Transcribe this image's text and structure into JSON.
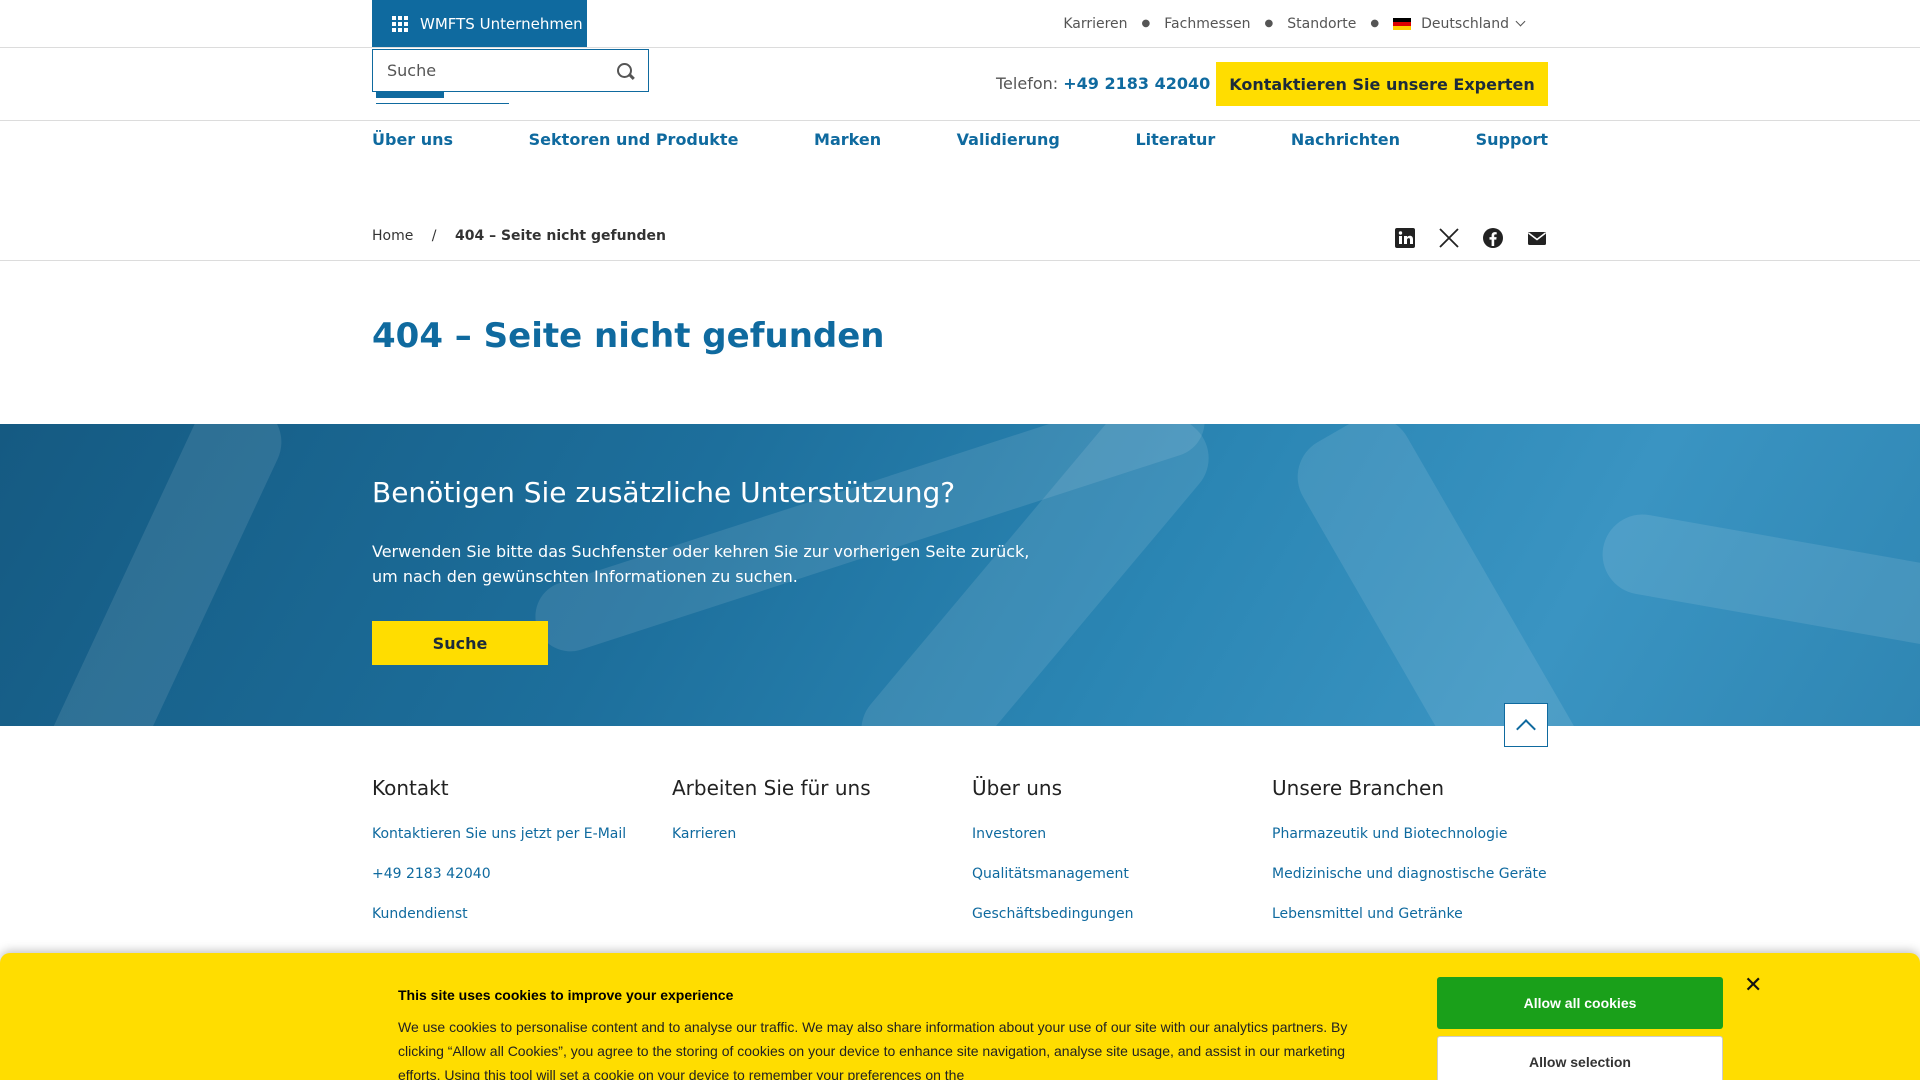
{
  "topbar": {
    "company_button": "WMFTS Unternehmen",
    "links": [
      "Karrieren",
      "Fachmessen",
      "Standorte"
    ],
    "language": "Deutschland"
  },
  "header": {
    "search_placeholder": "Suche",
    "phone_label": "Telefon:",
    "phone_number": "+49 2183 42040",
    "cta": "Kontaktieren Sie unsere Experten"
  },
  "nav": [
    "Über uns",
    "Sektoren und Produkte",
    "Marken",
    "Validierung",
    "Literatur",
    "Nachrichten",
    "Support"
  ],
  "breadcrumb": {
    "home": "Home",
    "current": "404 – Seite nicht gefunden"
  },
  "social_icons": [
    "linkedin-icon",
    "x-icon",
    "facebook-icon",
    "email-icon"
  ],
  "page_title": "404 – Seite nicht gefunden",
  "hero": {
    "heading": "Benötigen Sie zusätzliche Unterstützung?",
    "text": "Verwenden Sie bitte das Suchfenster oder kehren Sie zur vorherigen Seite zurück, um nach den gewünschten Informationen zu suchen.",
    "button": "Suche"
  },
  "footer": {
    "columns": [
      {
        "title": "Kontakt",
        "links": [
          "Kontaktieren Sie uns jetzt per E-Mail",
          "+49 2183 42040",
          "Kundendienst"
        ]
      },
      {
        "title": "Arbeiten Sie für uns",
        "links": [
          "Karrieren"
        ]
      },
      {
        "title": "Über uns",
        "links": [
          "Investoren",
          "Qualitätsmanagement",
          "Geschäftsbedingungen"
        ]
      },
      {
        "title": "Unsere Branchen",
        "links": [
          "Pharmazeutik und Biotechnologie",
          "Medizinische und diagnostische Geräte",
          "Lebensmittel und Getränke"
        ]
      }
    ]
  },
  "cookie": {
    "title": "This site uses cookies to improve your experience",
    "text": "We use cookies to personalise content and to analyse our traffic. We may also share information about your use of our site with our analytics partners. By clicking “Allow all Cookies”, you agree to the storing of cookies on your device to enhance site navigation, analyse site usage, and assist in our marketing efforts. Using this tool will set a cookie on your device to remember your preferences on the",
    "allow_all": "Allow all cookies",
    "allow_selection": "Allow selection"
  },
  "colors": {
    "brand_blue": "#0f6a9f",
    "accent_yellow": "#ffdd00",
    "allow_green": "#1aa01a"
  }
}
